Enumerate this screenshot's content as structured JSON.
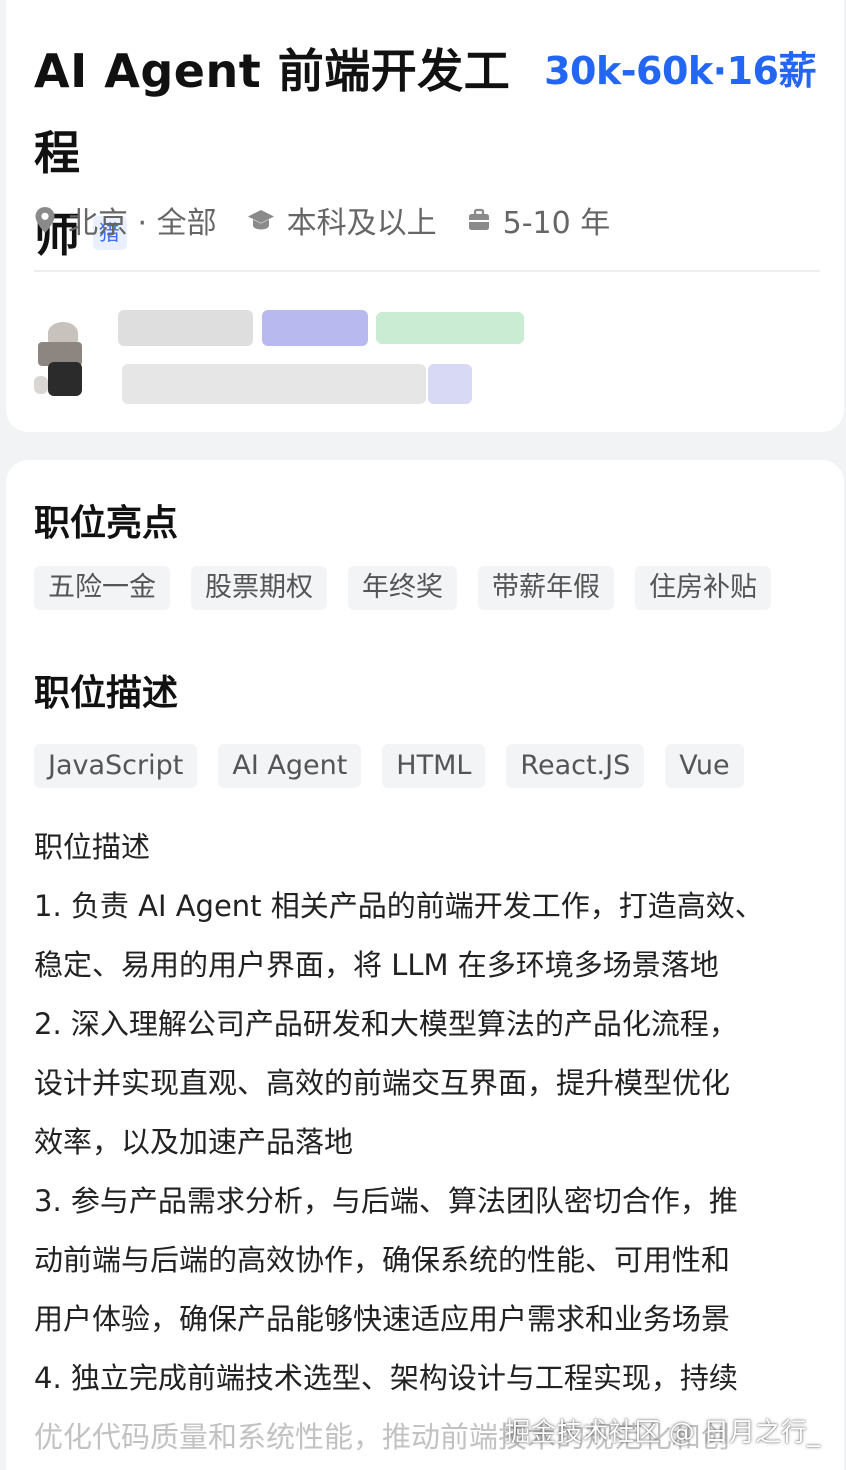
{
  "job": {
    "title_line1": "AI Agent 前端开发工程",
    "title_line2": "师",
    "hunt_tag": "猎",
    "salary": "30k-60k·16薪",
    "location": "北京 · 全部",
    "education": "本科及以上",
    "experience": "5-10 年"
  },
  "highlights": {
    "title": "职位亮点",
    "tags": [
      "五险一金",
      "股票期权",
      "年终奖",
      "带薪年假",
      "住房补贴"
    ]
  },
  "description": {
    "title": "职位描述",
    "skills": [
      "JavaScript",
      "AI Agent",
      "HTML",
      "React.JS",
      "Vue"
    ],
    "lines": [
      "职位描述",
      "1. 负责 AI Agent 相关产品的前端开发工作，打造高效、",
      "稳定、易用的用户界面，将 LLM 在多环境多场景落地",
      "2. 深入理解公司产品研发和大模型算法的产品化流程，",
      "设计并实现直观、高效的前端交互界面，提升模型优化",
      "效率，以及加速产品落地",
      "3. 参与产品需求分析，与后端、算法团队密切合作，推",
      "动前端与后端的高效协作，确保系统的性能、可用性和",
      "用户体验，确保产品能够快速适应用户需求和业务场景",
      "4. 独立完成前端技术选型、架构设计与工程实现，持续",
      "优化代码质量和系统性能，推动前端技术的规范化和创"
    ]
  },
  "watermark": "掘金技术社区 @ 日月之行_",
  "colors": {
    "accent": "#2466f4",
    "tag_bg": "#f3f4f6",
    "card_bg": "#ffffff",
    "page_bg": "#f2f3f5"
  },
  "icons": [
    "location-pin-icon",
    "graduation-cap-icon",
    "briefcase-icon"
  ]
}
